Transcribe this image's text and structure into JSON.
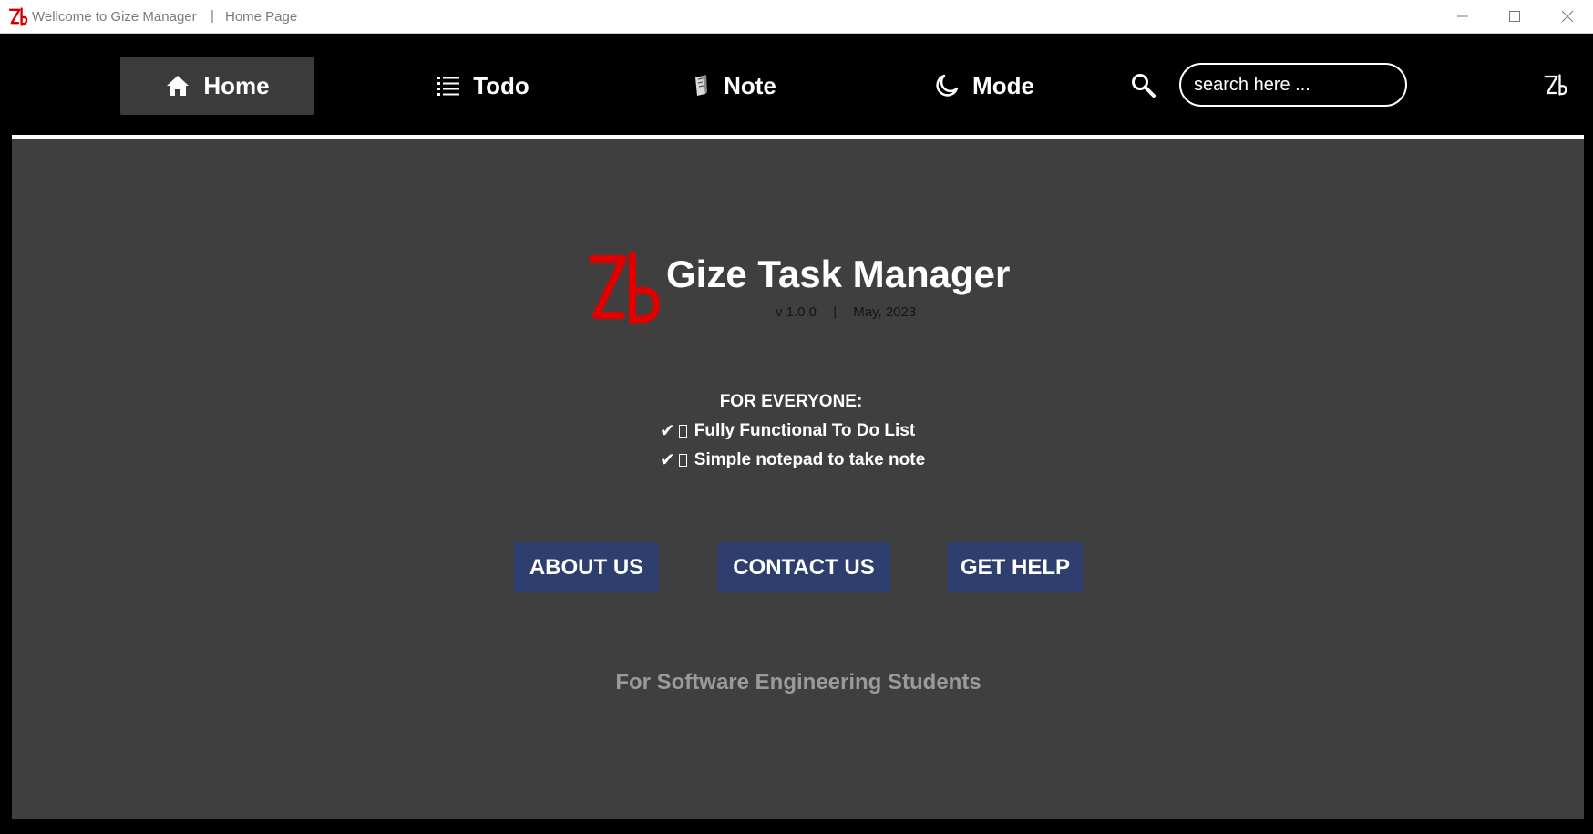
{
  "window": {
    "title": "Wellcome to Gize Manager",
    "separator": "|",
    "page": "Home Page",
    "controls": [
      "minimize-icon",
      "maximize-icon",
      "close-icon"
    ]
  },
  "nav": {
    "items": [
      {
        "label": "Home",
        "icon": "home-icon",
        "active": true
      },
      {
        "label": "Todo",
        "icon": "list-icon",
        "active": false
      },
      {
        "label": "Note",
        "icon": "note-icon",
        "active": false
      },
      {
        "label": "Mode",
        "icon": "moon-icon",
        "active": false
      }
    ],
    "search": {
      "icon": "search-icon",
      "placeholder": "search here ..."
    },
    "logo_icon": "gize-logo-icon"
  },
  "hero": {
    "title": "Gize Task Manager",
    "version": "v 1.0.0",
    "version_separator": "|",
    "date": "May, 2023",
    "logo_icon": "gize-logo-icon"
  },
  "features": {
    "heading": "FOR EVERYONE:",
    "items": [
      {
        "check": "✔",
        "text": "Fully Functional To Do List"
      },
      {
        "check": "✔",
        "text": "Simple notepad to take note"
      }
    ]
  },
  "buttons": {
    "about": "ABOUT US",
    "contact": "CONTACT US",
    "help": "GET HELP"
  },
  "tagline": "For Software Engineering Students",
  "colors": {
    "background": "#000000",
    "panel": "#3f3f3f",
    "active_nav": "#3b3b3b",
    "button": "#2e3e6e",
    "logo": "#e00000",
    "tagline": "#9a9a9a"
  }
}
